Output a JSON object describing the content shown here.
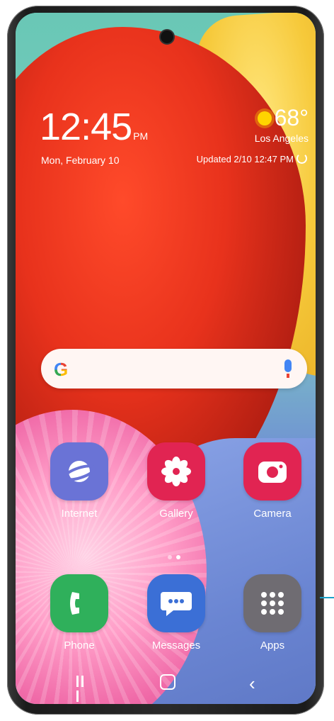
{
  "status": {
    "time": "12:45",
    "ampm": "PM",
    "date": "Mon, February 10"
  },
  "weather": {
    "temperature": "68°",
    "city": "Los Angeles",
    "updated": "Updated 2/10 12:47 PM"
  },
  "search": {
    "logo": "G",
    "mic_icon": "mic-icon"
  },
  "apps_row1": [
    {
      "label": "Internet",
      "icon": "planet-icon"
    },
    {
      "label": "Gallery",
      "icon": "flower-icon"
    },
    {
      "label": "Camera",
      "icon": "camera-icon"
    }
  ],
  "dock": [
    {
      "label": "Phone",
      "icon": "phone-icon"
    },
    {
      "label": "Messages",
      "icon": "chat-bubble-icon"
    },
    {
      "label": "Apps",
      "icon": "grid-icon"
    }
  ],
  "colors": {
    "internet": "#6a73d6",
    "gallery": "#e12452",
    "camera": "#e12452",
    "phone": "#2fb05b",
    "messages": "#3b6fd6",
    "apps": "#6f6c72"
  }
}
